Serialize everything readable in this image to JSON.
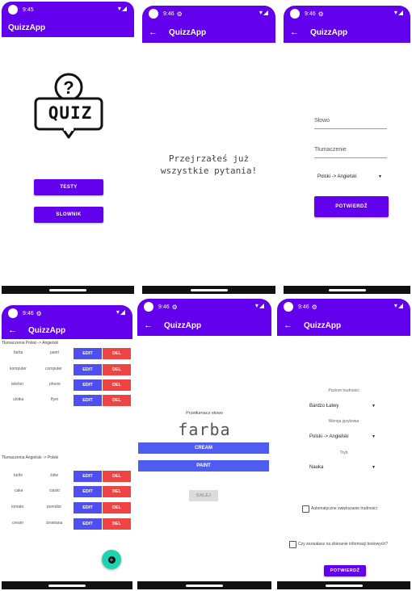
{
  "app_title": "QuizzApp",
  "colors": {
    "primary": "#6200ee",
    "blue_button": "#4f5cf0",
    "delete_button": "#ef4444",
    "fab": "#1ed3b0"
  },
  "screen1": {
    "time": "9:45",
    "logo_text": "QUIZ",
    "testy_button": "TESTY",
    "slownik_button": "SLOWNIK"
  },
  "screen2": {
    "time": "9:46",
    "message_line1": "Przejrzałeś już",
    "message_line2": "wszystkie pytania!"
  },
  "screen3": {
    "time": "9:46",
    "word_placeholder": "Słowo",
    "translation_placeholder": "Tłumaczenie",
    "language_select": "Polski -> Angielski",
    "confirm_button": "POTWIERDŹ"
  },
  "screen4": {
    "time": "9:46",
    "section1_title": "Tłumaczenia Polski -> Angielski",
    "section1_rows": [
      {
        "pl": "farba",
        "en": "paint"
      },
      {
        "pl": "komputer",
        "en": "computer"
      },
      {
        "pl": "telefon",
        "en": "phone"
      },
      {
        "pl": "ulotka",
        "en": "flyer"
      }
    ],
    "section2_title": "Tłumaczenia Angielski -> Polski",
    "section2_rows": [
      {
        "en": "turtle",
        "pl": "żółw"
      },
      {
        "en": "cake",
        "pl": "ciasto"
      },
      {
        "en": "tomato",
        "pl": "pomidor"
      },
      {
        "en": "cream",
        "pl": "śmietana"
      }
    ],
    "edit_label": "EDIT",
    "del_label": "DEL",
    "fab_icon": "plus-icon"
  },
  "screen5": {
    "time": "9:46",
    "prompt": "Przetłumacz słowo",
    "word": "farba",
    "option1": "CREAM",
    "option2": "PAINT",
    "next_button": "DALEJ"
  },
  "screen6": {
    "time": "9:46",
    "difficulty_label": "Poziom trudności",
    "difficulty_value": "Bardzo Łatwy",
    "language_label": "Wersja językowa",
    "language_value": "Polski -> Angielski",
    "mode_label": "Tryb",
    "mode_value": "Nauka",
    "auto_difficulty_label": "Automatyczne zwiększanie trudności",
    "consent_label": "Czy zezwalasz na zbieranie informacji testowych?",
    "confirm_button": "POTWIERDŹ"
  }
}
